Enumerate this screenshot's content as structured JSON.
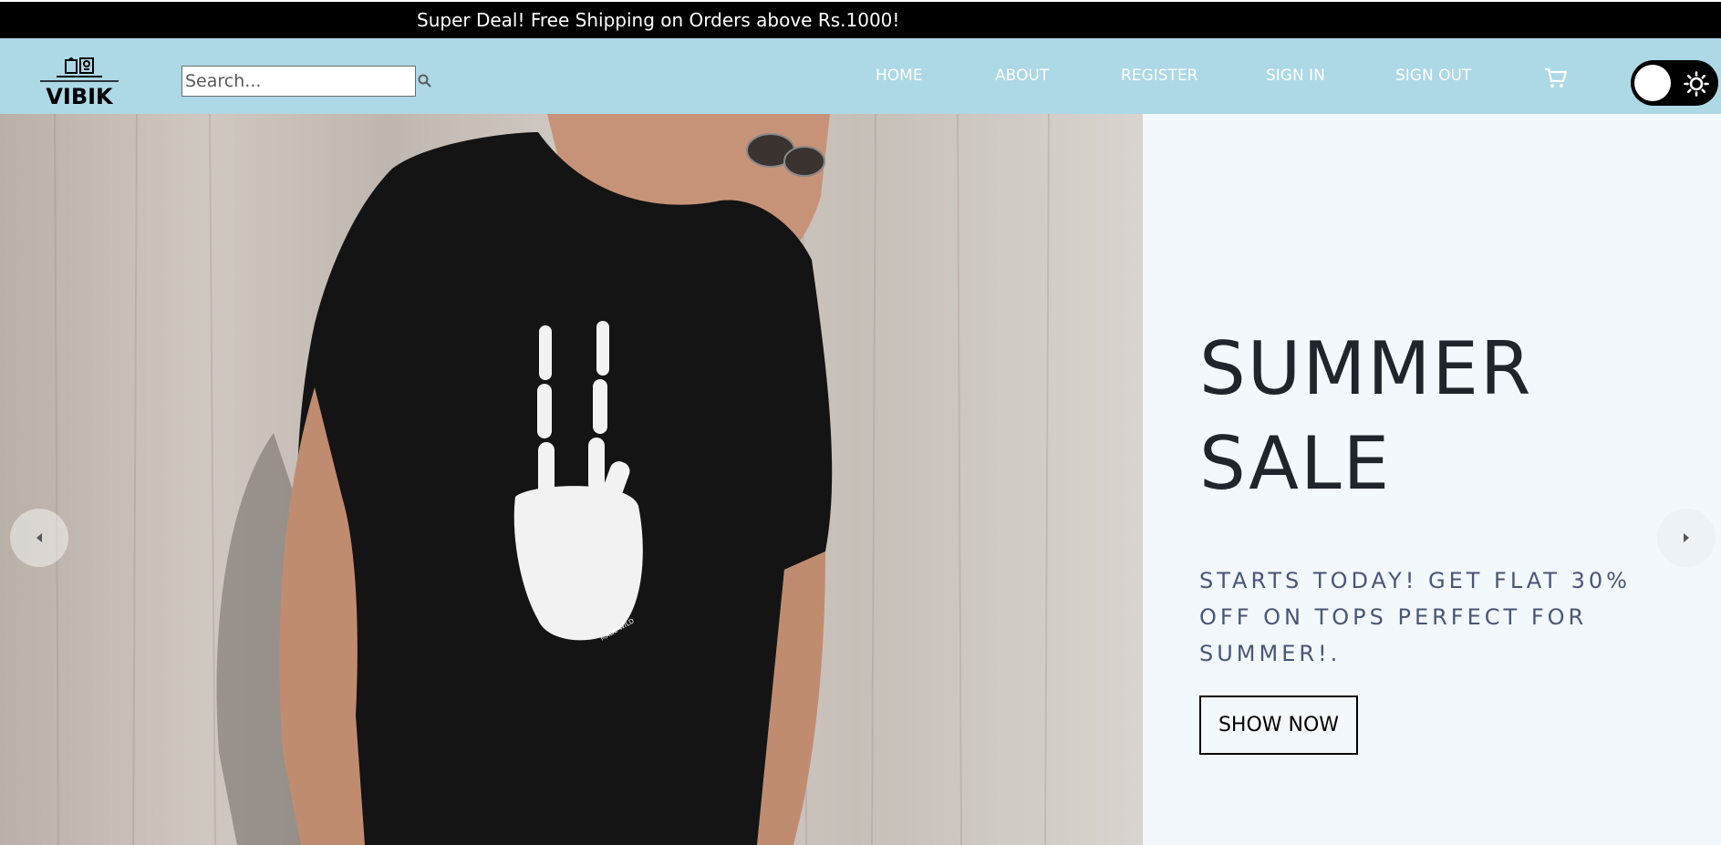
{
  "announcement": {
    "text": "Super Deal! Free Shipping on Orders above Rs.1000!"
  },
  "brand": {
    "name": "VIBIK",
    "logo_icon": "shirt-logo-icon"
  },
  "search": {
    "placeholder": "Search...",
    "value": "",
    "icon": "search-icon"
  },
  "nav": {
    "items": [
      {
        "label": "HOME"
      },
      {
        "label": "ABOUT"
      },
      {
        "label": "REGISTER"
      },
      {
        "label": "SIGN IN"
      },
      {
        "label": "SIGN OUT"
      }
    ],
    "cart_icon": "cart-icon"
  },
  "theme_toggle": {
    "state": "light",
    "icon": "sun-icon"
  },
  "hero": {
    "title": "SUMMER SALE",
    "description": "STARTS TODAY! GET FLAT 30% OFF ON TOPS PERFECT FOR SUMMER!.",
    "button_label": "SHOW NOW",
    "image_subject": "man in black t-shirt with skeleton peace hand print",
    "prev_icon": "chevron-left-icon",
    "next_icon": "chevron-right-icon"
  },
  "colors": {
    "navbar_bg": "#add8e6",
    "announcement_bg": "#000000",
    "hero_text_bg": "#f2f8fb",
    "title_color": "#1f252b",
    "description_color": "#4b5576"
  }
}
